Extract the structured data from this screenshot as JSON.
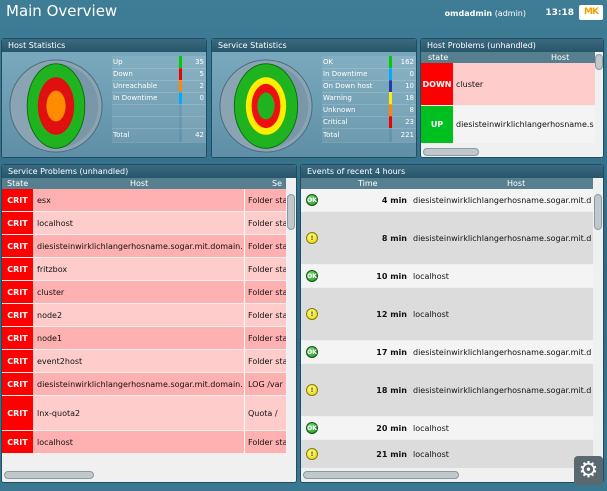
{
  "header": {
    "title": "Main Overview",
    "user": "omdadmin",
    "role": "(admin)",
    "time": "13:18",
    "logo_text": "MK"
  },
  "host_stats": {
    "title": "Host Statistics",
    "rows": [
      {
        "label": "Up",
        "value": "35",
        "color": "#00cc00"
      },
      {
        "label": "Down",
        "value": "5",
        "color": "#ee0000"
      },
      {
        "label": "Unreachable",
        "value": "2",
        "color": "#ff8800"
      },
      {
        "label": "In Downtime",
        "value": "0",
        "color": "#00aaff"
      }
    ],
    "total_label": "Total",
    "total_value": "42"
  },
  "service_stats": {
    "title": "Service Statistics",
    "rows": [
      {
        "label": "OK",
        "value": "162",
        "color": "#00cc00"
      },
      {
        "label": "In Downtime",
        "value": "0",
        "color": "#00aaff"
      },
      {
        "label": "On Down host",
        "value": "10",
        "color": "#1e3fa8"
      },
      {
        "label": "Warning",
        "value": "18",
        "color": "#ffee00"
      },
      {
        "label": "Unknown",
        "value": "8",
        "color": "#ff8800"
      },
      {
        "label": "Critical",
        "value": "23",
        "color": "#ee0000"
      }
    ],
    "total_label": "Total",
    "total_value": "221"
  },
  "host_problems": {
    "title": "Host Problems (unhandled)",
    "col_state": "state",
    "col_host": "Host",
    "rows": [
      {
        "state": "DOWN",
        "host": "cluster"
      },
      {
        "state": "UP",
        "host": "diesisteinwirklichlangerhosname.s"
      }
    ]
  },
  "service_problems": {
    "title": "Service Problems (unhandled)",
    "col_state": "State",
    "col_host": "Host",
    "col_service": "Se",
    "rows": [
      {
        "state": "CRIT",
        "host": "esx",
        "service": "Folder sta"
      },
      {
        "state": "CRIT",
        "host": "localhost",
        "service": "Folder sta"
      },
      {
        "state": "CRIT",
        "host": "diesisteinwirklichlangerhosname.sogar.mit.domain.de",
        "service": "Folder sta"
      },
      {
        "state": "CRIT",
        "host": "fritzbox",
        "service": "Folder sta"
      },
      {
        "state": "CRIT",
        "host": "cluster",
        "service": "Folder sta"
      },
      {
        "state": "CRIT",
        "host": "node2",
        "service": "Folder sta"
      },
      {
        "state": "CRIT",
        "host": "node1",
        "service": "Folder sta"
      },
      {
        "state": "CRIT",
        "host": "event2host",
        "service": "Folder sta"
      },
      {
        "state": "CRIT",
        "host": "diesisteinwirklichlangerhosname.sogar.mit.domain.de",
        "service": "LOG /var"
      },
      {
        "state": "CRIT",
        "host": "lnx-quota2",
        "service": "Quota /"
      },
      {
        "state": "CRIT",
        "host": "localhost",
        "service": "Folder sta"
      }
    ]
  },
  "events": {
    "title": "Events of recent 4 hours",
    "col_time": "Time",
    "col_host": "Host",
    "rows": [
      {
        "icon": "ok",
        "icon_text": "OK",
        "time": "4 min",
        "host": "diesisteinwirklichlangerhosname.sogar.mit.d"
      },
      {
        "icon": "warn",
        "icon_text": "!",
        "time": "8 min",
        "host": "diesisteinwirklichlangerhosname.sogar.mit.d"
      },
      {
        "icon": "ok",
        "icon_text": "OK",
        "time": "10 min",
        "host": "localhost"
      },
      {
        "icon": "warn",
        "icon_text": "!",
        "time": "12 min",
        "host": "localhost"
      },
      {
        "icon": "ok",
        "icon_text": "OK",
        "time": "17 min",
        "host": "diesisteinwirklichlangerhosname.sogar.mit.d"
      },
      {
        "icon": "warn",
        "icon_text": "!",
        "time": "18 min",
        "host": "diesisteinwirklichlangerhosname.sogar.mit.d"
      },
      {
        "icon": "ok",
        "icon_text": "OK",
        "time": "20 min",
        "host": "localhost"
      },
      {
        "icon": "warn",
        "icon_text": "!",
        "time": "21 min",
        "host": "localhost"
      }
    ]
  },
  "colors": {
    "crit": "#ff0000",
    "crit_row_a": "#ffb0b0",
    "crit_row_b": "#ffcccc",
    "up": "#00c020",
    "event_row_a": "#f4f4f4",
    "event_row_b": "#dcdcdc"
  }
}
